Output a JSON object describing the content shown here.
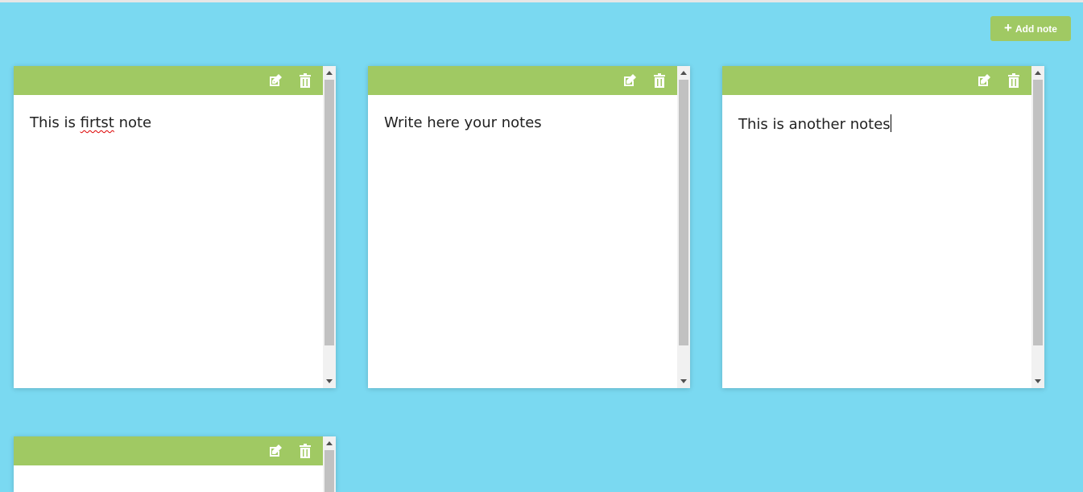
{
  "toolbar": {
    "add_note_label": "Add note",
    "add_note_icon": "plus-icon"
  },
  "colors": {
    "background": "#7ad9f1",
    "accent": "#a0c963",
    "note_background": "#ffffff"
  },
  "notes": [
    {
      "text_before": "This is ",
      "text_misspelled": "firtst",
      "text_after": " note",
      "edit_icon": "edit-icon",
      "delete_icon": "trash-icon"
    },
    {
      "text": "Write here your notes",
      "edit_icon": "edit-icon",
      "delete_icon": "trash-icon"
    },
    {
      "text": "This is another notes",
      "edit_icon": "edit-icon",
      "delete_icon": "trash-icon",
      "focused": true
    },
    {
      "text": "",
      "edit_icon": "edit-icon",
      "delete_icon": "trash-icon"
    }
  ]
}
